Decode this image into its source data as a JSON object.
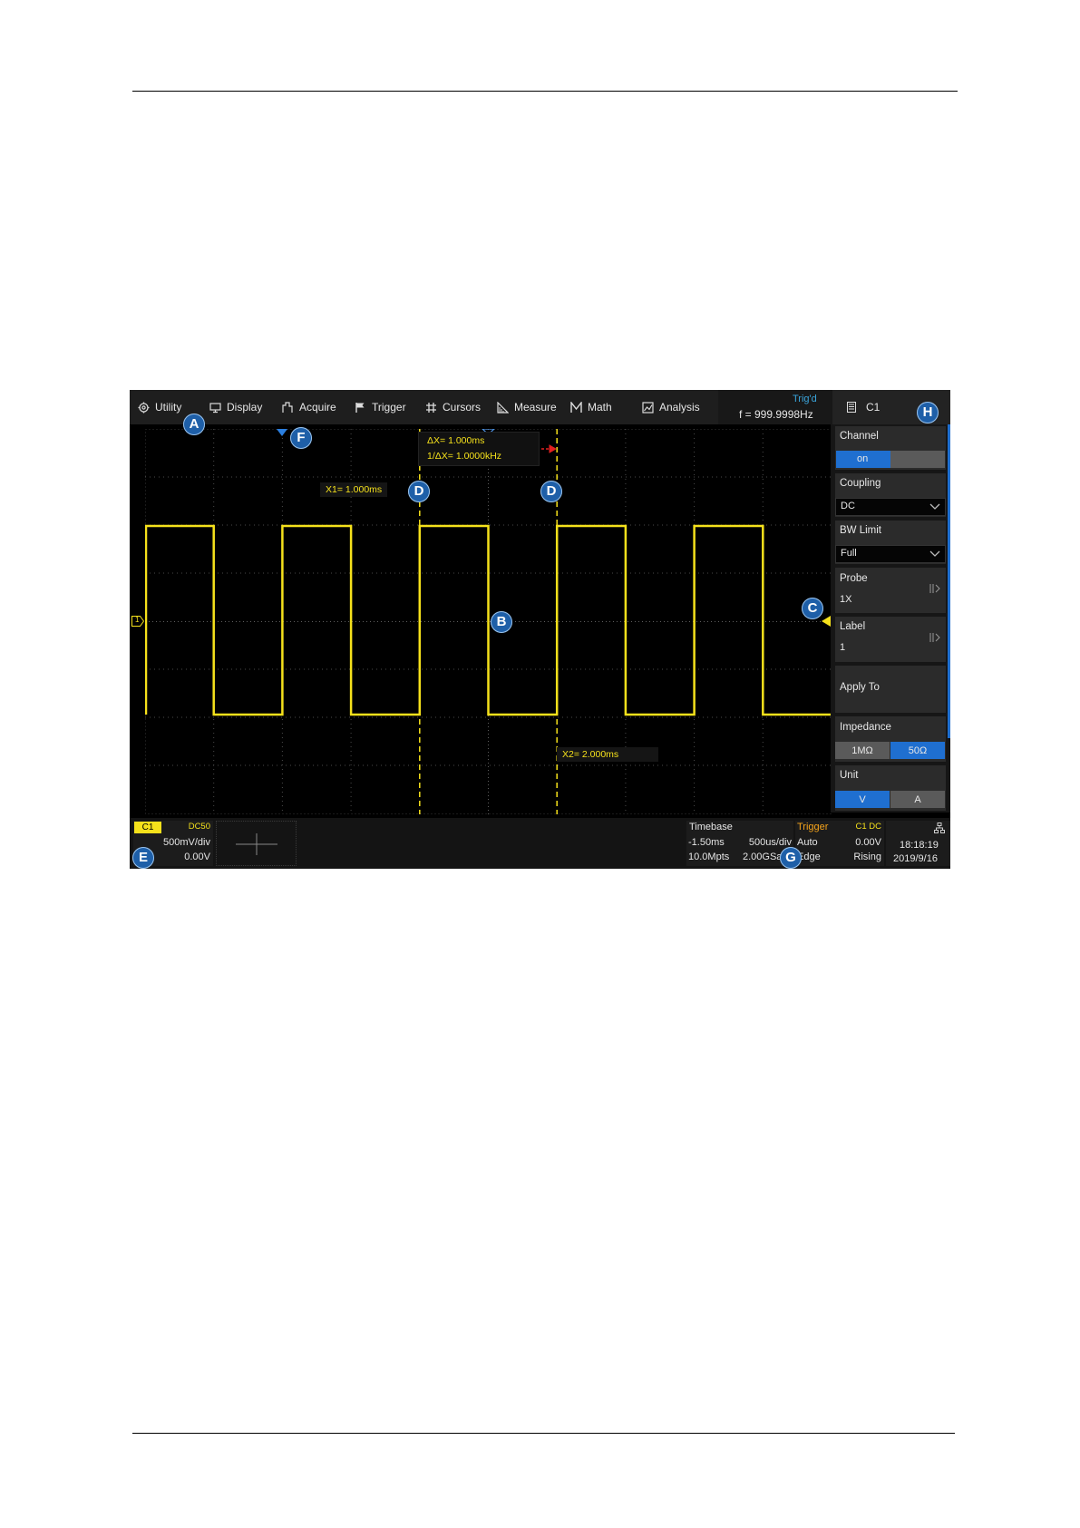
{
  "menu": {
    "items": [
      {
        "label": "Utility",
        "icon": "gear-icon"
      },
      {
        "label": "Display",
        "icon": "monitor-icon"
      },
      {
        "label": "Acquire",
        "icon": "acquire-icon"
      },
      {
        "label": "Trigger",
        "icon": "flag-icon"
      },
      {
        "label": "Cursors",
        "icon": "hash-icon"
      },
      {
        "label": "Measure",
        "icon": "ruler-icon"
      },
      {
        "label": "Math",
        "icon": "math-icon"
      },
      {
        "label": "Analysis",
        "icon": "analysis-icon"
      }
    ],
    "trig_status": "Trig'd",
    "frequency": "f = 999.9998Hz",
    "channel_icon": "document-icon",
    "channel": "C1"
  },
  "cursors": {
    "delta_x": "ΔX= 1.000ms",
    "inv_delta_x": "1/ΔX= 1.0000kHz",
    "x1": "X1= 1.000ms",
    "x2": "X2= 2.000ms"
  },
  "panel": {
    "channel": {
      "label": "Channel",
      "on": "on"
    },
    "coupling": {
      "label": "Coupling",
      "value": "DC"
    },
    "bw_limit": {
      "label": "BW Limit",
      "value": "Full"
    },
    "probe": {
      "label": "Probe",
      "value": "1X"
    },
    "label": {
      "label": "Label",
      "value": "1"
    },
    "apply_to": {
      "label": "Apply To"
    },
    "impedance": {
      "label": "Impedance",
      "options": [
        "1MΩ",
        "50Ω"
      ],
      "selected": "50Ω"
    },
    "unit": {
      "label": "Unit",
      "options": [
        "V",
        "A"
      ],
      "selected": "V"
    }
  },
  "status": {
    "channel": {
      "name": "C1",
      "coupling": "DC50",
      "scale": "500mV/div",
      "offset": "0.00V"
    },
    "timebase": {
      "label": "Timebase",
      "delay": "-1.50ms",
      "scale": "500us/div",
      "memory": "10.0Mpts",
      "sample_rate": "2.00GSa"
    },
    "trigger": {
      "label": "Trigger",
      "source": "C1 DC",
      "mode": "Auto",
      "level": "0.00V",
      "type": "Edge",
      "slope": "Rising"
    },
    "time": "18:18:19",
    "date": "2019/9/16"
  },
  "markers": {
    "trigger_level": "1"
  },
  "callouts": {
    "a": "A",
    "b": "B",
    "c": "C",
    "d1": "D",
    "d2": "D",
    "e": "E",
    "f": "F",
    "g": "G",
    "h": "H"
  },
  "colors": {
    "trace": "#f5e11b",
    "accent": "#1f6fd0",
    "callout": "#1e5fa8",
    "cursor_delta": "#e32020"
  }
}
